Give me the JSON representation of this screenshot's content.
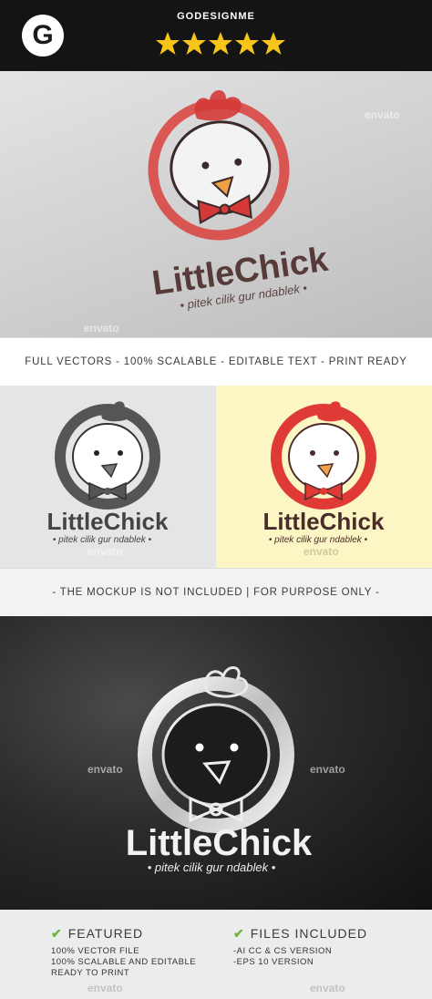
{
  "header": {
    "badge_letter": "G",
    "brand": "GODESIGNME",
    "rating_stars": 5
  },
  "logo": {
    "name_part1": "Little",
    "name_part2": "Chick",
    "tagline": "• pitek cilik gur ndablek •",
    "colors": {
      "red": "#e03a36",
      "dark_brown": "#4a2c2a",
      "beak": "#f2a04a",
      "gray": "#555555"
    }
  },
  "banner1": {
    "text": "FULL VECTORS - 100% SCALABLE - EDITABLE TEXT - PRINT READY"
  },
  "banner2": {
    "text": "- THE MOCKUP IS NOT INCLUDED  |  FOR PURPOSE ONLY -"
  },
  "watermark": "envato",
  "footer": {
    "featured": {
      "title": "FEATURED",
      "lines": [
        "100% VECTOR FILE",
        "100% SCALABLE AND EDITABLE",
        "READY TO PRINT"
      ]
    },
    "files": {
      "title": "FILES INCLUDED",
      "lines": [
        "-AI CC & CS VERSION",
        "-EPS 10 VERSION"
      ]
    }
  }
}
